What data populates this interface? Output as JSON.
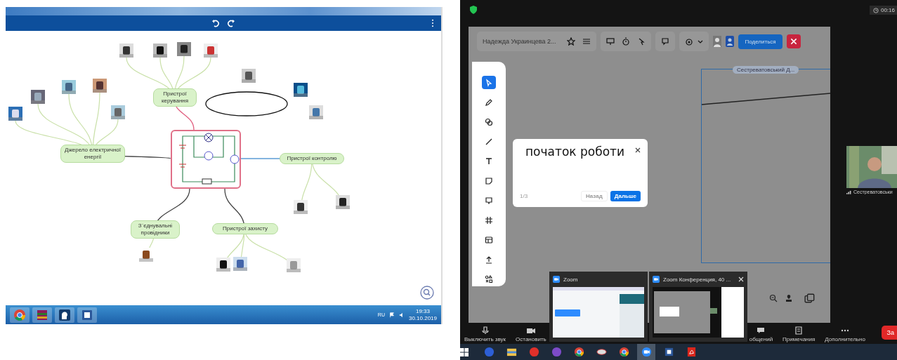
{
  "mind_map": {
    "nodes": [
      {
        "label": "Джерело електричної енергії"
      },
      {
        "label": "Пристрої керування"
      },
      {
        "label": "Пристрої контролю"
      },
      {
        "label": "З`єднувальні провідники"
      },
      {
        "label": "Пристрої захисту"
      }
    ]
  },
  "left_taskbar": {
    "language": "RU",
    "time": "19:33",
    "date": "30.10.2019"
  },
  "right_window": {
    "timer": "00:16",
    "board": {
      "title": "Надежда Украинцева 2...",
      "share_button": "Поделиться",
      "tools": [
        {
          "kind": "select",
          "selected": true
        },
        {
          "kind": "pen",
          "selected": false
        },
        {
          "kind": "shapes",
          "selected": false
        },
        {
          "kind": "line",
          "selected": false
        },
        {
          "kind": "text",
          "selected": false
        },
        {
          "kind": "sticky",
          "selected": false
        },
        {
          "kind": "comment",
          "selected": false
        },
        {
          "kind": "frame",
          "selected": false
        },
        {
          "kind": "template",
          "selected": false
        },
        {
          "kind": "upload",
          "selected": false
        },
        {
          "kind": "more",
          "selected": false
        }
      ],
      "frame_label": "Сестреватовський Д...",
      "popup": {
        "text": "початок роботи",
        "counter": "1/3",
        "back_button": "Назад",
        "next_button": "Дальше"
      }
    },
    "participant": "Сестреватовськи",
    "meeting_controls": [
      {
        "kind": "mic",
        "label": "Выключить звук"
      },
      {
        "kind": "camera",
        "label": "Остановить"
      },
      {
        "kind": "chat",
        "label": "общений"
      },
      {
        "kind": "notes",
        "label": "Примечания"
      },
      {
        "kind": "more",
        "label": "Дополнительно"
      }
    ],
    "end_button": "За",
    "previews": [
      {
        "title": "Zoom",
        "closable": false
      },
      {
        "title": "Zoom Конференция, 40 ...",
        "closable": true
      }
    ],
    "taskbar_apps": [
      {
        "kind": "blue",
        "selected": false
      },
      {
        "kind": "folder",
        "selected": false
      },
      {
        "kind": "red",
        "selected": false
      },
      {
        "kind": "purple",
        "selected": false
      },
      {
        "kind": "chrome",
        "selected": false
      },
      {
        "kind": "grey",
        "selected": false
      },
      {
        "kind": "chrome",
        "selected": false
      },
      {
        "kind": "zoom",
        "selected": true
      },
      {
        "kind": "word",
        "selected": false
      },
      {
        "kind": "pdf",
        "selected": false
      }
    ]
  }
}
